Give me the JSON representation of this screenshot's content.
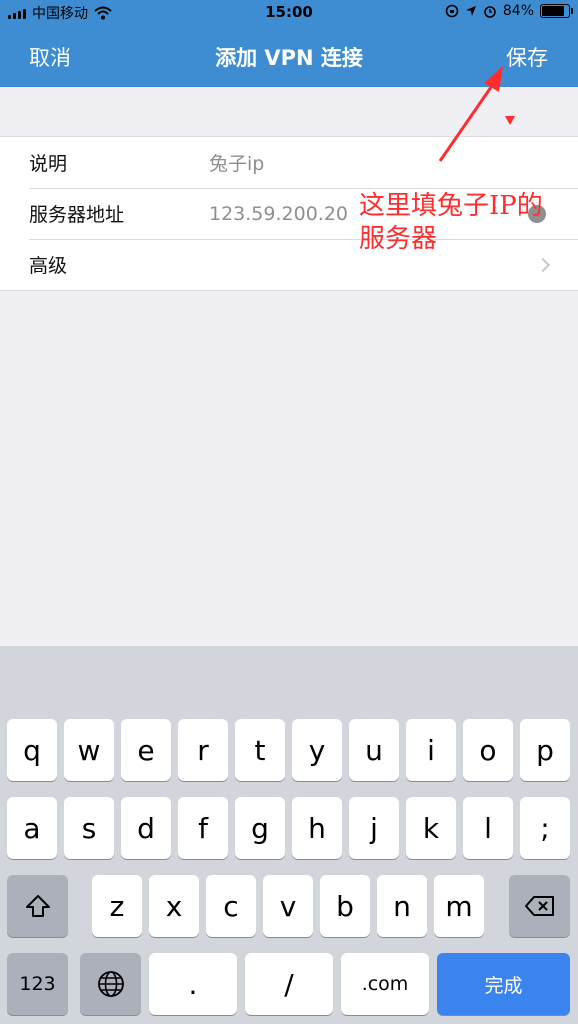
{
  "status_bar": {
    "carrier": "中国移动",
    "time": "15:00",
    "battery_percent": "84%",
    "battery_level": 0.84,
    "icons": [
      "signal-icon",
      "wifi-icon",
      "rotation-lock-icon",
      "location-icon",
      "alarm-icon",
      "battery-icon"
    ]
  },
  "nav": {
    "cancel_label": "取消",
    "title": "添加 VPN 连接",
    "save_label": "保存",
    "background_color": "#3e8dd3"
  },
  "form": {
    "rows": [
      {
        "label": "说明",
        "value": "兔子ip"
      },
      {
        "label": "服务器地址",
        "value": "123.59.200.20"
      },
      {
        "label": "高级",
        "value": ""
      }
    ]
  },
  "annotation": {
    "line1": "这里填兔子IP的",
    "line2": "服务器",
    "color": "#ff2d2d"
  },
  "keyboard": {
    "row1": [
      "q",
      "w",
      "e",
      "r",
      "t",
      "y",
      "u",
      "i",
      "o",
      "p"
    ],
    "row2": [
      "a",
      "s",
      "d",
      "f",
      "g",
      "h",
      "j",
      "k",
      "l",
      ";"
    ],
    "row3": [
      "z",
      "x",
      "c",
      "v",
      "b",
      "n",
      "m"
    ],
    "numbers_label": "123",
    "dot_label": ".",
    "slash_label": "/",
    "com_label": ".com",
    "done_label": "完成",
    "accent_color": "#3a84f0"
  }
}
